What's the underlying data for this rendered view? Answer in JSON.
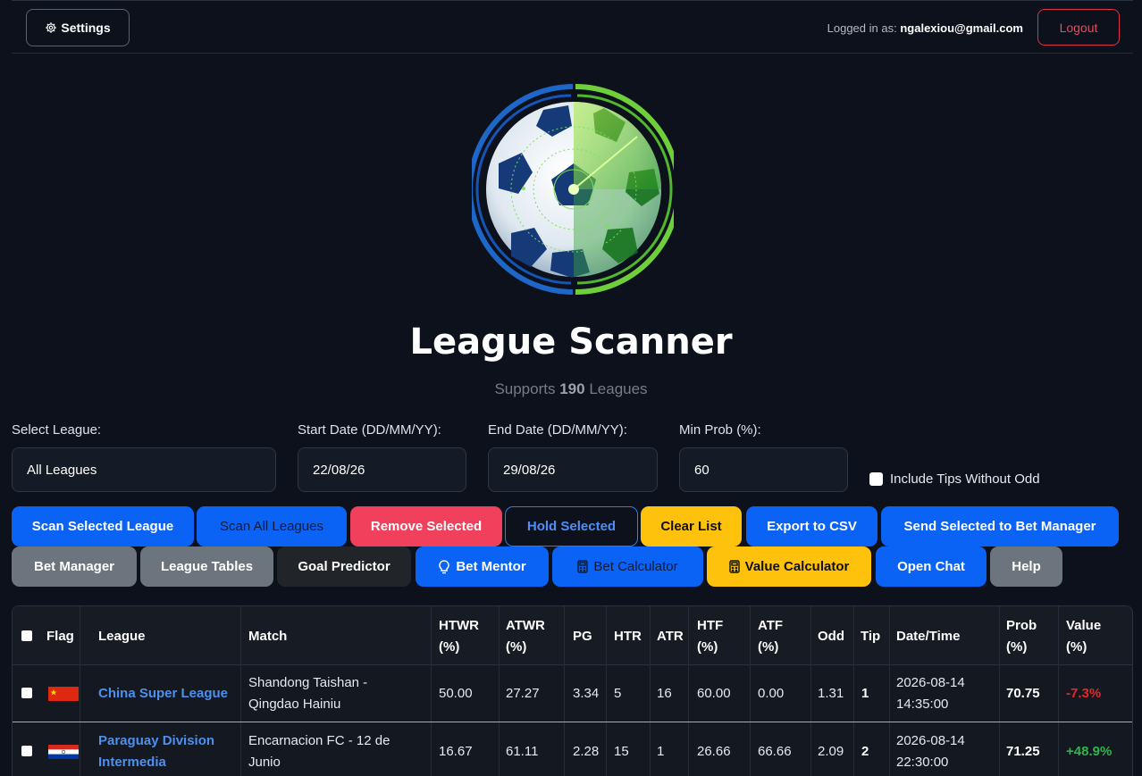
{
  "header": {
    "settings_label": "Settings",
    "logged_in_prefix": "Logged in as:",
    "user_email": "ngalexiou@gmail.com",
    "logout_label": "Logout"
  },
  "hero": {
    "title": "League Scanner",
    "supports_prefix": "Supports",
    "league_count": "190",
    "supports_suffix": "Leagues"
  },
  "filters": {
    "league_label": "Select League:",
    "league_value": "All Leagues",
    "start_label": "Start Date (DD/MM/YY):",
    "start_value": "22/08/26",
    "end_label": "End Date (DD/MM/YY):",
    "end_value": "29/08/26",
    "minprob_label": "Min Prob (%):",
    "minprob_value": "60",
    "include_tips_label": "Include Tips Without Odd"
  },
  "toolbar_row1": {
    "scan_selected": "Scan Selected League",
    "scan_all": "Scan All Leagues",
    "remove_selected": "Remove Selected",
    "hold_selected": "Hold Selected",
    "clear_list": "Clear List",
    "export_csv": "Export to CSV",
    "send_bet_manager": "Send Selected to Bet Manager"
  },
  "toolbar_row2": {
    "bet_manager": "Bet Manager",
    "league_tables": "League Tables",
    "goal_predictor": "Goal Predictor",
    "bet_mentor": "Bet Mentor",
    "bet_calculator": "Bet Calculator",
    "value_calculator": "Value Calculator",
    "open_chat": "Open Chat",
    "help": "Help"
  },
  "table": {
    "headers": {
      "flag": "Flag",
      "league": "League",
      "match": "Match",
      "htwr_1": "HTWR",
      "htwr_2": "(%)",
      "atwr_1": "ATWR",
      "atwr_2": "(%)",
      "pg": "PG",
      "htr": "HTR",
      "atr": "ATR",
      "htf_1": "HTF",
      "htf_2": "(%)",
      "atf_1": "ATF",
      "atf_2": "(%)",
      "odd": "Odd",
      "tip": "Tip",
      "datetime": "Date/Time",
      "prob_1": "Prob",
      "prob_2": "(%)",
      "value_1": "Value",
      "value_2": "(%)"
    },
    "rows": [
      {
        "league": "China Super League",
        "match_1": "Shandong Taishan -",
        "match_2": "Qingdao Hainiu",
        "htwr": "50.00",
        "atwr": "27.27",
        "pg": "3.34",
        "htr": "5",
        "atr": "16",
        "htf": "60.00",
        "atf": "0.00",
        "odd": "1.31",
        "tip": "1",
        "date": "2026-08-14",
        "time": "14:35:00",
        "prob": "70.75",
        "value": "-7.3%"
      },
      {
        "league_1": "Paraguay Division",
        "league_2": "Intermedia",
        "match_1": "Encarnacion FC - 12 de",
        "match_2": "Junio",
        "htwr": "16.67",
        "atwr": "61.11",
        "pg": "2.28",
        "htr": "15",
        "atr": "1",
        "htf": "26.66",
        "atf": "66.66",
        "odd": "2.09",
        "tip": "2",
        "date": "2026-08-14",
        "time": "22:30:00",
        "prob": "71.25",
        "value": "+48.9%"
      }
    ]
  },
  "colors": {
    "background": "#0c111b",
    "primary": "#0b63f6",
    "danger": "#f0405c",
    "warning": "#fec10c",
    "secondary": "#6c757d",
    "link": "#4d90f0",
    "negative": "#e02929",
    "positive": "#2fb54a"
  }
}
